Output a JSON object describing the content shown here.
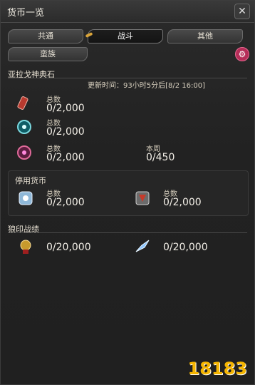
{
  "window": {
    "title": "货币一览",
    "close_icon": "close-icon"
  },
  "tabs": {
    "row1": [
      {
        "label": "共通",
        "active": false
      },
      {
        "label": "战斗",
        "active": true
      },
      {
        "label": "其他",
        "active": false
      }
    ],
    "row2": [
      {
        "label": "蛮族"
      }
    ],
    "settings_icon": "gear-icon",
    "accent": "#d9a43a"
  },
  "allagan": {
    "title": "亚拉戈神典石",
    "update_text": "更新时间：93小时5分后[8/2 16:00]",
    "items": [
      {
        "label": "总数",
        "value": "0/2,000",
        "icon": "red-tome-icon"
      },
      {
        "label": "总数",
        "value": "0/2,000",
        "icon": "teal-disc-icon"
      },
      {
        "label": "总数",
        "value": "0/2,000",
        "icon": "purple-disc-icon",
        "weekly_label": "本周",
        "weekly_value": "0/450"
      }
    ]
  },
  "discontinued": {
    "title": "停用货币",
    "items": [
      {
        "label": "总数",
        "value": "0/2,000",
        "icon": "blue-tile-icon"
      },
      {
        "label": "总数",
        "value": "0/2,000",
        "icon": "red-emblem-icon"
      }
    ]
  },
  "wolf": {
    "title": "狼印战绩",
    "items": [
      {
        "value": "0/20,000",
        "icon": "wolf-mark-medal-icon"
      },
      {
        "value": "0/20,000",
        "icon": "crystal-shard-icon"
      }
    ]
  },
  "watermark": {
    "text": "18183"
  }
}
